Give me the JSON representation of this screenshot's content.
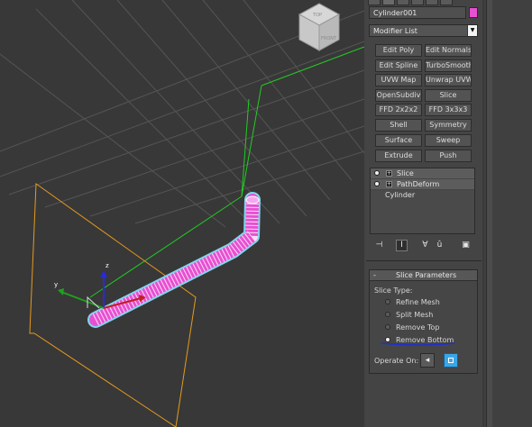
{
  "viewcube": {
    "front_label": "FRONT",
    "top_label": "TOP"
  },
  "gizmo": {
    "z_label": "z",
    "y_label": "y",
    "x_label": "x"
  },
  "object": {
    "name": "Cylinder001",
    "color": "#e850d2"
  },
  "modifier_list": {
    "label": "Modifier List"
  },
  "modifier_buttons": [
    "Edit Poly",
    "Edit Normals",
    "Edit Spline",
    "TurboSmooth",
    "UVW Map",
    "Unwrap UVW",
    "OpenSubdiv",
    "Slice",
    "FFD 2x2x2",
    "FFD 3x3x3",
    "Shell",
    "Symmetry",
    "Surface",
    "Sweep",
    "Extrude",
    "Push"
  ],
  "stack": [
    {
      "label": "Slice",
      "type": "modifier"
    },
    {
      "label": "PathDeform",
      "type": "modifier"
    },
    {
      "label": "Cylinder",
      "type": "base"
    }
  ],
  "stack_toolbar": [
    "pin-stack-icon",
    "show-end-result-icon",
    "make-unique-icon",
    "remove-modifier-icon",
    "configure-sets-icon"
  ],
  "slice_parameters": {
    "toggle": "-",
    "title": "Slice Parameters",
    "slice_type_label": "Slice Type:",
    "options": [
      "Refine Mesh",
      "Split Mesh",
      "Remove Top",
      "Remove Bottom"
    ],
    "selected": "Remove Bottom",
    "operate_on_label": "Operate On:"
  },
  "colors": {
    "selection_wire": "#e850d2",
    "spline": "#22cc22",
    "slice_plane": "#e59a1e",
    "annotation": "#1f2fd0"
  }
}
